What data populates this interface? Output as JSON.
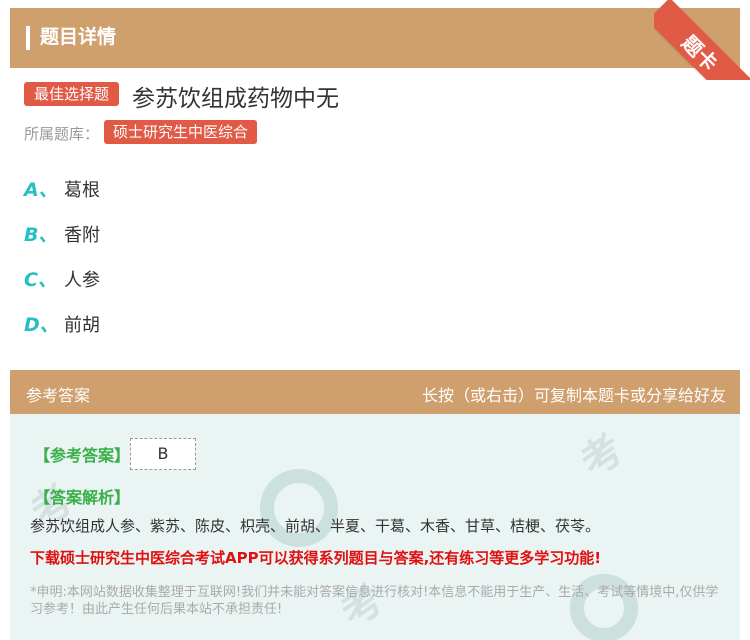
{
  "header": {
    "title": "题目详情",
    "ribbon": "题卡"
  },
  "question": {
    "tag": "最佳选择题",
    "text": "参苏饮组成药物中无",
    "bank_label": "所属题库：",
    "bank": "硕士研究生中医综合"
  },
  "options": [
    {
      "letter": "A、",
      "text": "葛根"
    },
    {
      "letter": "B、",
      "text": "香附"
    },
    {
      "letter": "C、",
      "text": "人参"
    },
    {
      "letter": "D、",
      "text": "前胡"
    }
  ],
  "answer_section": {
    "title": "参考答案",
    "hint": "长按（或右击）可复制本题卡或分享给好友",
    "ref_label": "【参考答案】",
    "ref_value": "B",
    "analysis_label": "【答案解析】",
    "analysis_text": "参苏饮组成人参、紫苏、陈皮、枳壳、前胡、半夏、干葛、木香、甘草、桔梗、茯苓。",
    "promo": "下载硕士研究生中医综合考试APP可以获得系列题目与答案,还有练习等更多学习功能!",
    "disclaimer": "*申明:本网站数据收集整理于互联网!我们并未能对答案信息进行核对!本信息不能用于生产、生活、考试等情境中,仅供学习参考！由此产生任何后果本站不承担责任!"
  },
  "colors": {
    "header_bg": "#CF9F6E",
    "tag_red": "#E05A46",
    "option_letter": "#26C0C4",
    "answer_green": "#3BB04A",
    "promo_red": "#E01010",
    "answer_bg": "#EAF4F3"
  }
}
